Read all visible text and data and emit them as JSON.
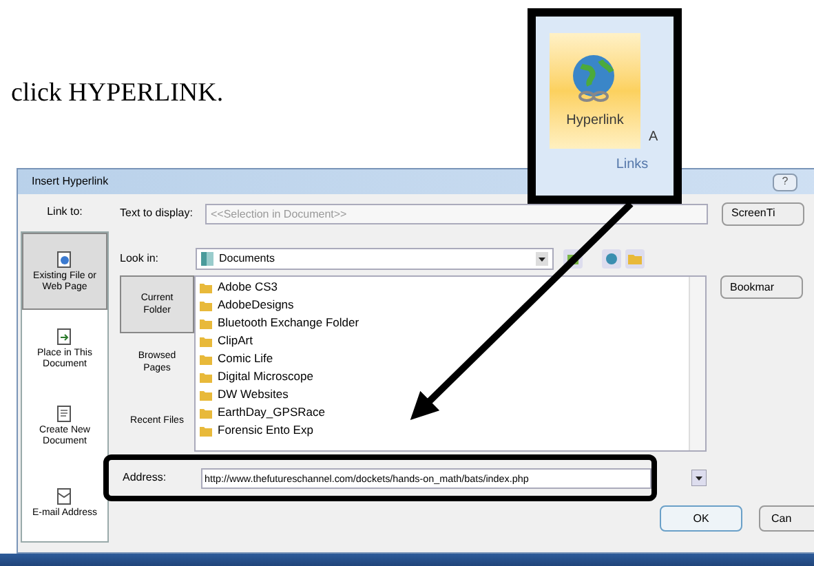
{
  "document": {
    "instruction": "click HYPERLINK."
  },
  "ribbon_inset": {
    "button_label": "Hyperlink",
    "next_label": "A",
    "group_label": "Links"
  },
  "dialog": {
    "title": "Insert Hyperlink",
    "help": "?",
    "link_to_label": "Link to:",
    "link_to": [
      {
        "label": "Existing File or Web Page",
        "selected": true
      },
      {
        "label": "Place in This Document",
        "selected": false
      },
      {
        "label": "Create New Document",
        "selected": false
      },
      {
        "label": "E-mail Address",
        "selected": false
      }
    ],
    "text_to_display": {
      "label": "Text to display:",
      "placeholder": "<<Selection in Document>>"
    },
    "screentip_button": "ScreenTi",
    "look_in": {
      "label": "Look in:",
      "value": "Documents"
    },
    "views": [
      {
        "label": "Current Folder",
        "selected": true
      },
      {
        "label": "Browsed Pages",
        "selected": false
      },
      {
        "label": "Recent Files",
        "selected": false
      }
    ],
    "files": [
      "Adobe CS3",
      "AdobeDesigns",
      "Bluetooth Exchange Folder",
      "ClipArt",
      "Comic Life",
      "Digital Microscope",
      "DW Websites",
      "EarthDay_GPSRace",
      "Forensic Ento Exp"
    ],
    "bookmark_button": "Bookmar",
    "address": {
      "label": "Address:",
      "value": "http://www.thefutureschannel.com/dockets/hands-on_math/bats/index.php"
    },
    "ok_button": "OK",
    "cancel_button": "Can"
  }
}
